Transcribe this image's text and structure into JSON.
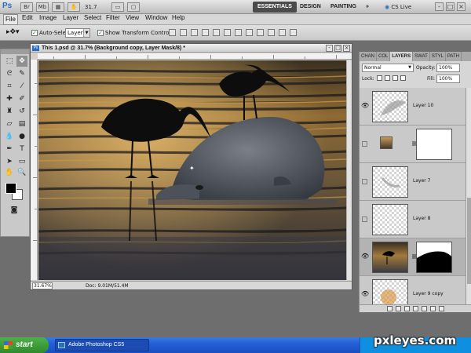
{
  "app": {
    "logo": "Ps",
    "zoom": "31.7",
    "workspaces": [
      "ESSENTIALS",
      "DESIGN",
      "PAINTING"
    ],
    "more": "»",
    "cs_live": "CS Live",
    "window_controls": [
      "-",
      "□",
      "×"
    ]
  },
  "menu": [
    "File",
    "Edit",
    "Image",
    "Layer",
    "Select",
    "Filter",
    "View",
    "Window",
    "Help"
  ],
  "options": {
    "auto_select_label": "Auto-Select:",
    "auto_select_value": "Layer",
    "show_transform_label": "Show Transform Controls"
  },
  "document": {
    "title": "This 1.psd @ 31.7% (Background copy, Layer Mask/8) *",
    "zoom": "31.67%",
    "doc_info": "Doc: 9.01M/51.4M"
  },
  "panel": {
    "tabs": [
      "CHAN",
      "COL",
      "LAYERS",
      "SWAT",
      "STYL",
      "PATH"
    ],
    "active_tab": "LAYERS",
    "blend_mode": "Normal",
    "opacity_label": "Opacity:",
    "opacity_value": "100%",
    "lock_label": "Lock:",
    "fill_label": "Fill:",
    "fill_value": "100%",
    "layers": [
      {
        "name": "Layer 10",
        "visible": true
      },
      {
        "name": "",
        "visible": false,
        "type": "adjustment"
      },
      {
        "name": "Layer 7",
        "visible": false
      },
      {
        "name": "Layer 8",
        "visible": false
      },
      {
        "name": "",
        "visible": true,
        "type": "masked-image",
        "active": true
      },
      {
        "name": "Layer 9 copy",
        "visible": true
      }
    ]
  },
  "taskbar": {
    "start": "start",
    "task": "Adobe Photoshop CS5"
  },
  "watermark": "pxleyes.com"
}
